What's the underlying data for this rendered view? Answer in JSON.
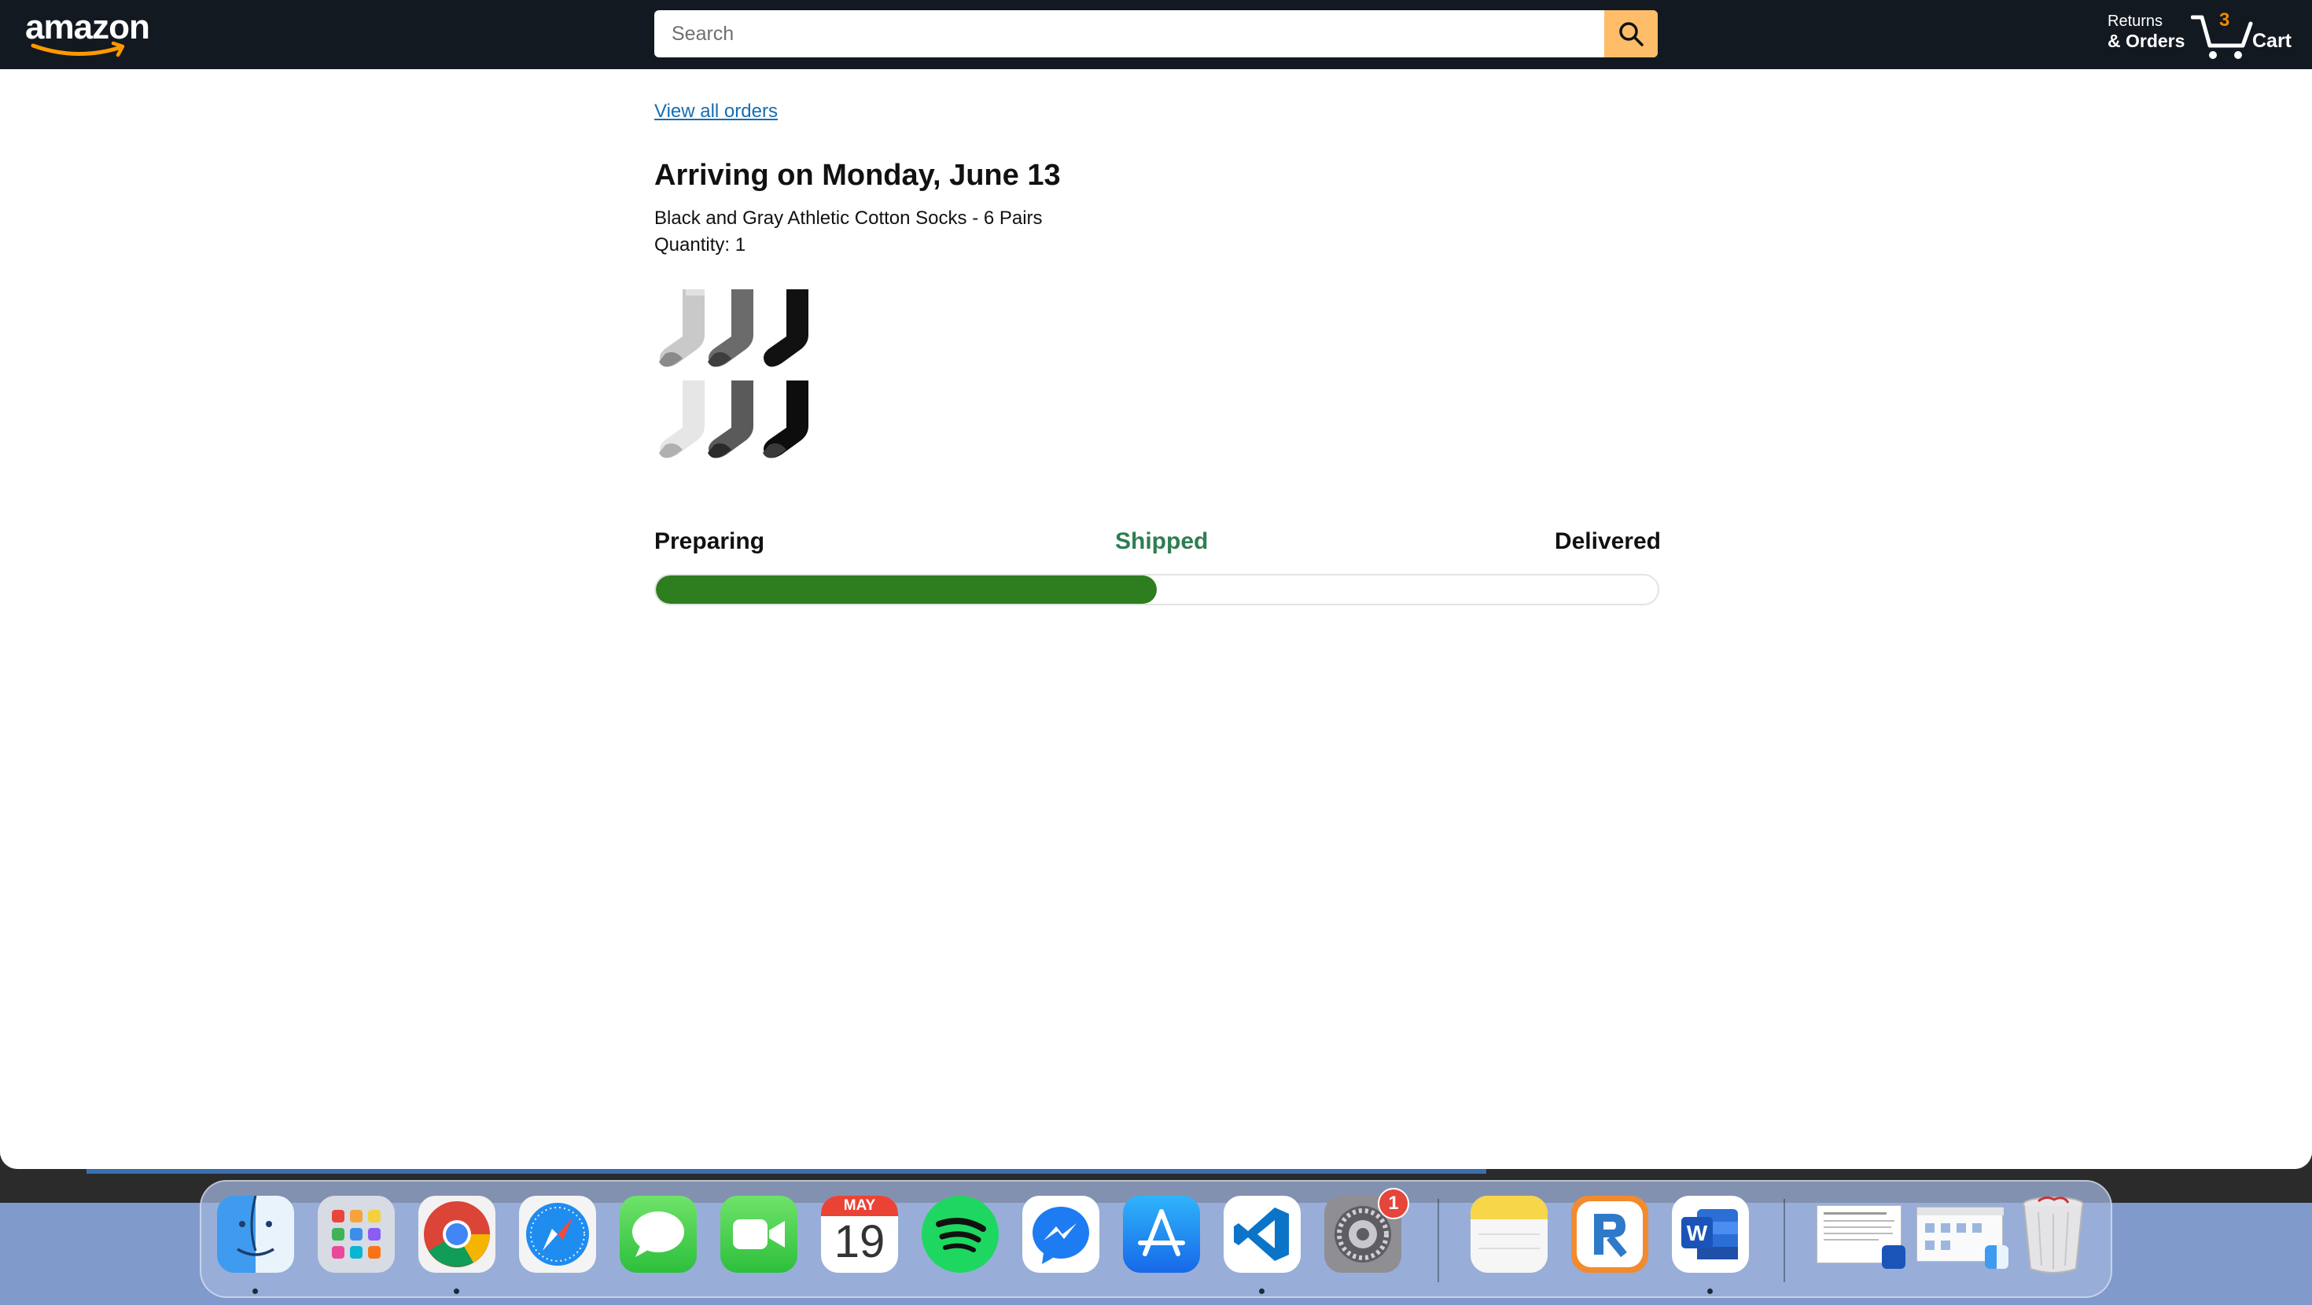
{
  "header": {
    "logo_text": "amazon",
    "search_placeholder": "Search",
    "returns_line1": "Returns",
    "returns_line2": "& Orders",
    "cart_count": "3",
    "cart_label": "Cart"
  },
  "order": {
    "view_all_link": "View all orders",
    "arriving_title": "Arriving on Monday, June 13",
    "product_name": "Black and Gray Athletic Cotton Socks - 6 Pairs",
    "quantity_label": "Quantity: 1"
  },
  "tracking": {
    "steps": [
      "Preparing",
      "Shipped",
      "Delivered"
    ],
    "current_step": "Shipped",
    "progress_fraction": 0.5
  },
  "dock": {
    "apps": [
      "finder-icon",
      "launchpad-icon",
      "chrome-icon",
      "safari-icon",
      "messages-icon",
      "facetime-icon",
      "calendar-icon",
      "spotify-icon",
      "messenger-icon",
      "app-store-icon",
      "vscode-icon",
      "system-settings-icon",
      "notes-icon",
      "rd-icon",
      "word-icon",
      "word-document-thumbnail",
      "finder-window-thumbnail",
      "trash-icon"
    ],
    "calendar_month": "MAY",
    "calendar_day": "19",
    "settings_badge": "1"
  },
  "colors": {
    "header_bg": "#131921",
    "search_button": "#febd69",
    "link": "#146eb4",
    "progress_fill": "#2e7d1e",
    "shipped_text": "#2f7d52"
  }
}
